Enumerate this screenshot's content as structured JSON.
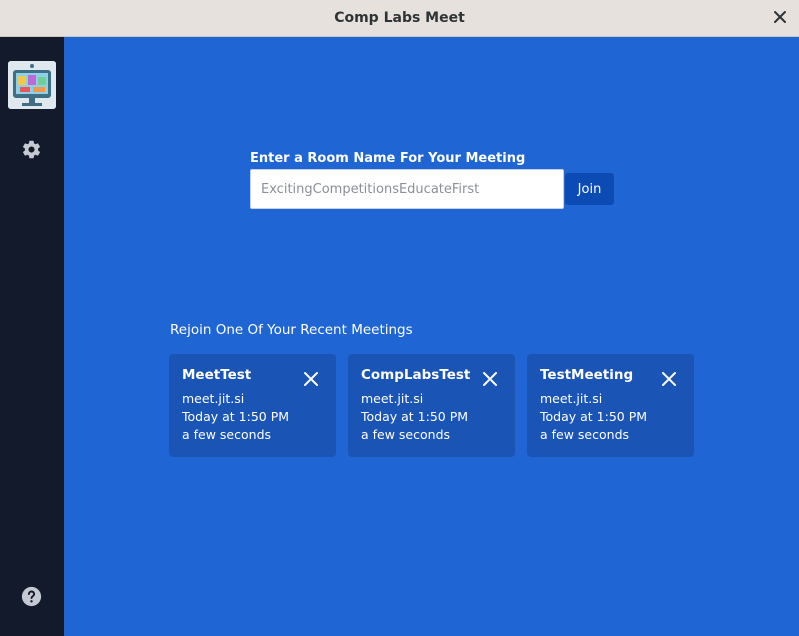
{
  "window": {
    "title": "Comp Labs Meet"
  },
  "sidebar": {
    "logo": "app-logo",
    "icons": [
      "gear-icon",
      "help-icon"
    ]
  },
  "room": {
    "label": "Enter a Room Name For Your Meeting",
    "placeholder": "ExcitingCompetitionsEducateFirst",
    "join_label": "Join"
  },
  "recent": {
    "label": "Rejoin One Of Your Recent Meetings",
    "meetings": [
      {
        "name": "MeetTest",
        "server": "meet.jit.si",
        "date": "Today at 1:50 PM",
        "duration": "a few seconds"
      },
      {
        "name": "CompLabsTest",
        "server": "meet.jit.si",
        "date": "Today at 1:50 PM",
        "duration": "a few seconds"
      },
      {
        "name": "TestMeeting",
        "server": "meet.jit.si",
        "date": "Today at 1:50 PM",
        "duration": "a few seconds"
      }
    ]
  },
  "colors": {
    "main_bg": "#1f66d4",
    "sidebar_bg": "#131a2b",
    "card_bg": "#1a55b5",
    "button_bg": "#0c4bb3"
  }
}
